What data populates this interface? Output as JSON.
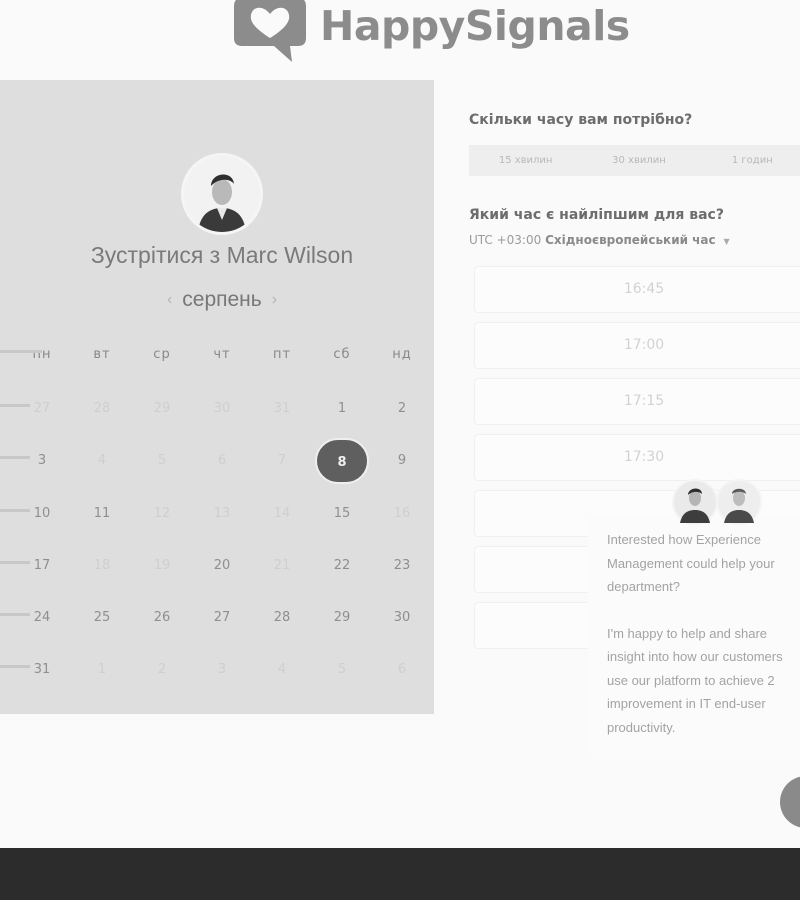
{
  "brand": {
    "name": "HappySignals"
  },
  "calendar": {
    "title": "Зустрітися з Marc Wilson",
    "month": "серпень",
    "prev_icon": "chevron-left-icon",
    "next_icon": "chevron-right-icon",
    "weekdays": [
      "пн",
      "вт",
      "ср",
      "чт",
      "пт",
      "сб",
      "нд"
    ],
    "weeks": [
      [
        {
          "d": "27",
          "m": true
        },
        {
          "d": "28",
          "m": true
        },
        {
          "d": "29",
          "m": true
        },
        {
          "d": "30",
          "m": true
        },
        {
          "d": "31",
          "m": true
        },
        {
          "d": "1",
          "m": false
        },
        {
          "d": "2",
          "m": false
        }
      ],
      [
        {
          "d": "3",
          "m": false
        },
        {
          "d": "4",
          "m": true
        },
        {
          "d": "5",
          "m": true
        },
        {
          "d": "6",
          "m": true
        },
        {
          "d": "7",
          "m": true
        },
        {
          "d": "8",
          "m": false,
          "sel": true
        },
        {
          "d": "9",
          "m": false
        }
      ],
      [
        {
          "d": "10",
          "m": false
        },
        {
          "d": "11",
          "m": false
        },
        {
          "d": "12",
          "m": true
        },
        {
          "d": "13",
          "m": true
        },
        {
          "d": "14",
          "m": true
        },
        {
          "d": "15",
          "m": false
        },
        {
          "d": "16",
          "m": true
        }
      ],
      [
        {
          "d": "17",
          "m": false
        },
        {
          "d": "18",
          "m": true
        },
        {
          "d": "19",
          "m": true
        },
        {
          "d": "20",
          "m": false
        },
        {
          "d": "21",
          "m": true
        },
        {
          "d": "22",
          "m": false
        },
        {
          "d": "23",
          "m": false
        }
      ],
      [
        {
          "d": "24",
          "m": false
        },
        {
          "d": "25",
          "m": false
        },
        {
          "d": "26",
          "m": false
        },
        {
          "d": "27",
          "m": false
        },
        {
          "d": "28",
          "m": false
        },
        {
          "d": "29",
          "m": false
        },
        {
          "d": "30",
          "m": false
        }
      ],
      [
        {
          "d": "31",
          "m": false
        },
        {
          "d": "1",
          "m": true
        },
        {
          "d": "2",
          "m": true
        },
        {
          "d": "3",
          "m": true
        },
        {
          "d": "4",
          "m": true
        },
        {
          "d": "5",
          "m": true
        },
        {
          "d": "6",
          "m": true
        }
      ]
    ]
  },
  "booking": {
    "duration_question": "Скільки часу вам потрібно?",
    "durations": [
      "15 хвилин",
      "30 хвилин",
      "1 годин"
    ],
    "time_question": "Який час є найліпшим для вас?",
    "timezone_offset": "UTC +03:00",
    "timezone_name": "Східноєвропейський час",
    "timezone_icon": "caret-down-icon",
    "slots": [
      "16:45",
      "17:00",
      "17:15",
      "17:30"
    ]
  },
  "chat": {
    "lines_1": [
      "Interested how Experience",
      "Management could help your",
      "department?"
    ],
    "lines_2": [
      "I'm happy to help and share",
      "insight into how our customers",
      "use our platform to achieve 2",
      "improvement in IT end-user",
      "productivity."
    ]
  },
  "colors": {
    "panel": "#dedede",
    "selected_day": "#5f5f5f",
    "footer": "#2c2c2c"
  }
}
